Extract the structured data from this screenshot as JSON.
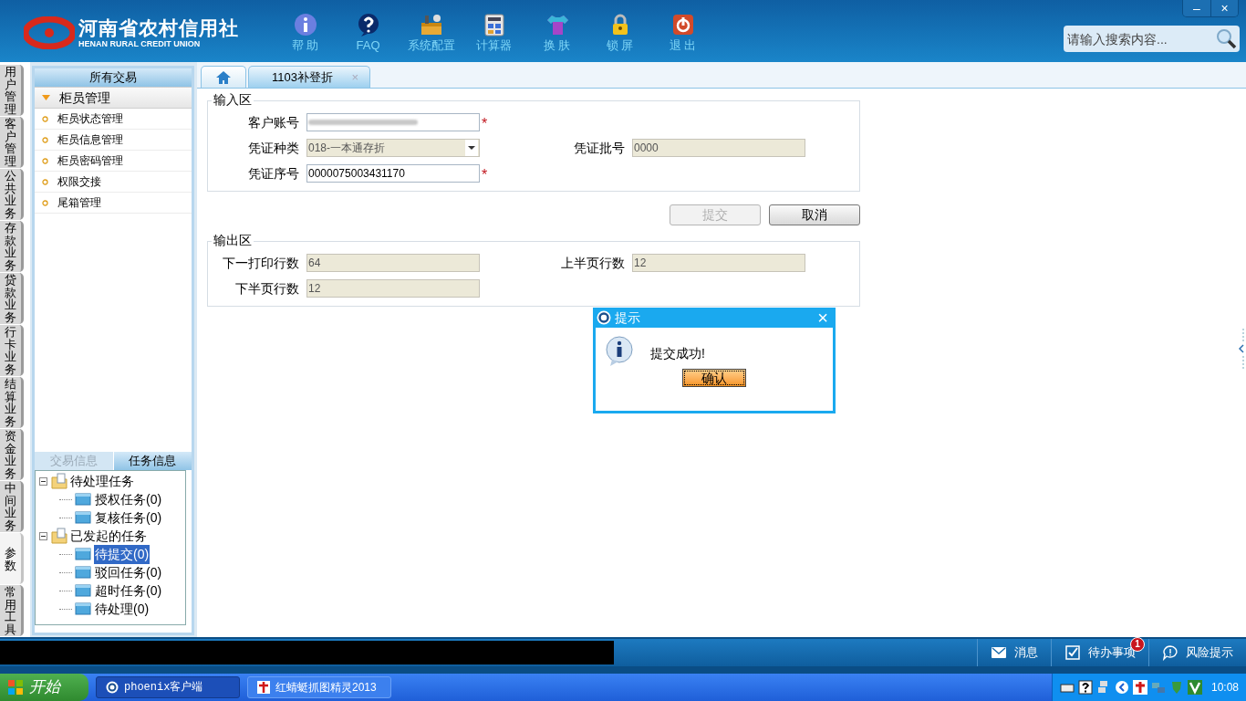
{
  "header": {
    "logo_title": "河南省农村信用社",
    "logo_subtitle": "HENAN RURAL CREDIT UNION",
    "toolbar": [
      {
        "kind": "info",
        "label": "帮 助"
      },
      {
        "kind": "faq",
        "label": "FAQ"
      },
      {
        "kind": "toolbox",
        "label": "系统配置"
      },
      {
        "kind": "calc",
        "label": "计算器"
      },
      {
        "kind": "shirt",
        "label": "换 肤"
      },
      {
        "kind": "lock",
        "label": "锁 屏"
      },
      {
        "kind": "exit",
        "label": "退 出"
      }
    ],
    "window_controls": [
      "–",
      "×"
    ],
    "search": {
      "placeholder": "请输入搜索内容..."
    }
  },
  "left_tabs": [
    {
      "label": "用户管理",
      "selected": false
    },
    {
      "label": "客户管理",
      "selected": false
    },
    {
      "label": "公共业务",
      "selected": false
    },
    {
      "label": "存款业务",
      "selected": false
    },
    {
      "label": "贷款业务",
      "selected": false
    },
    {
      "label": "行卡业务",
      "selected": false
    },
    {
      "label": "结算业务",
      "selected": false
    },
    {
      "label": "资金业务",
      "selected": false
    },
    {
      "label": "中间业务",
      "selected": false
    },
    {
      "label": "参数",
      "selected": true
    },
    {
      "label": "常用工具",
      "selected": false
    }
  ],
  "nav": {
    "title": "所有交易",
    "group": {
      "label": "柜员管理",
      "expanded": true
    },
    "items": [
      "柜员状态管理",
      "柜员信息管理",
      "柜员密码管理",
      "权限交接",
      "尾箱管理"
    ]
  },
  "task_panel": {
    "tabs": [
      {
        "label": "交易信息",
        "selected": false
      },
      {
        "label": "任务信息",
        "selected": true
      }
    ],
    "tree": [
      {
        "label": "待处理任务",
        "expanded": true,
        "children": [
          {
            "label": "授权任务(0)",
            "selected": false
          },
          {
            "label": "复核任务(0)",
            "selected": false
          }
        ]
      },
      {
        "label": "已发起的任务",
        "expanded": true,
        "children": [
          {
            "label": "待提交(0)",
            "selected": true
          },
          {
            "label": "驳回任务(0)",
            "selected": false
          },
          {
            "label": "超时任务(0)",
            "selected": false
          },
          {
            "label": "待处理(0)",
            "selected": false
          }
        ]
      }
    ]
  },
  "content_tabs": [
    {
      "kind": "home",
      "selected": false
    },
    {
      "kind": "page",
      "label": "1103补登折",
      "close": "×",
      "selected": true
    }
  ],
  "input_section": {
    "title": "输入区",
    "rows": [
      [
        {
          "label": "客户账号",
          "kind": "redacted",
          "required_mark": "*",
          "disabled": false
        }
      ],
      [
        {
          "label": "凭证种类",
          "kind": "select",
          "value": "018-一本通存折",
          "disabled": true
        },
        {
          "label": "凭证批号",
          "kind": "text",
          "value": "0000",
          "disabled": true
        }
      ],
      [
        {
          "label": "凭证序号",
          "kind": "text",
          "value": "0000075003431170",
          "required_mark": "*",
          "disabled": false
        }
      ]
    ]
  },
  "buttons": [
    {
      "label": "提交",
      "disabled": true
    },
    {
      "label": "取消",
      "disabled": false
    }
  ],
  "output_section": {
    "title": "输出区",
    "rows": [
      [
        {
          "label": "下一打印行数",
          "kind": "text",
          "value": "64",
          "disabled": true
        },
        {
          "label": "上半页行数",
          "kind": "text",
          "value": "12",
          "disabled": true
        }
      ],
      [
        {
          "label": "下半页行数",
          "kind": "text",
          "value": "12",
          "disabled": true
        }
      ]
    ]
  },
  "dialog": {
    "title": "提示",
    "close": "×",
    "message": "提交成功!",
    "button": "确认"
  },
  "status_bar": [
    {
      "kind": "mail",
      "label": "消息"
    },
    {
      "kind": "check",
      "label": "待办事项",
      "badge": "1"
    },
    {
      "kind": "chat",
      "label": "风险提示"
    }
  ],
  "taskbar": {
    "start": "开始",
    "windows": [
      {
        "kind": "app",
        "label": "phoenix客户端",
        "selected": true
      },
      {
        "kind": "capture",
        "label": "红蜻蜓抓图精灵2013",
        "selected": false
      }
    ],
    "clock": "10:08"
  }
}
